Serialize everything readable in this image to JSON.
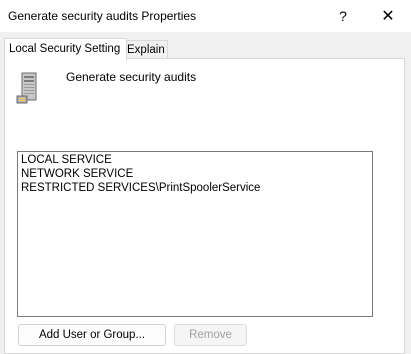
{
  "window": {
    "title": "Generate security audits Properties",
    "help_glyph": "?",
    "close_glyph": "✕"
  },
  "tabs": [
    {
      "label": "Local Security Setting",
      "active": true
    },
    {
      "label": "Explain",
      "active": false
    }
  ],
  "policy": {
    "name": "Generate security audits",
    "icon": "computer-tower-icon"
  },
  "accounts": [
    "LOCAL SERVICE",
    "NETWORK SERVICE",
    "RESTRICTED SERVICES\\PrintSpoolerService"
  ],
  "buttons": {
    "add_label": "Add User or Group...",
    "remove_label": "Remove",
    "remove_enabled": false
  }
}
